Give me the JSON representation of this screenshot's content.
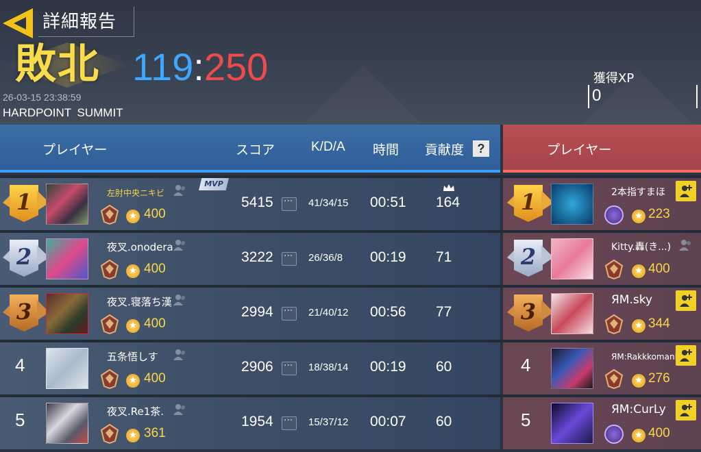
{
  "header": {
    "title": "詳細報告",
    "result": "敗北",
    "score_team": "119",
    "score_sep": ":",
    "score_enemy": "250",
    "datetime": "26-03-15 23:38:59",
    "mode": "HARDPOINT SUMMIT",
    "xp_label": "獲得XP",
    "xp_value": "0"
  },
  "columns": {
    "player": "プレイヤー",
    "score": "スコア",
    "kda": "K/D/A",
    "time": "時間",
    "contribution": "貢献度",
    "help": "?",
    "enemy_player": "プレイヤー"
  },
  "badges": {
    "mvp": "MVP"
  },
  "colors": {
    "team": "#3ea8ff",
    "enemy": "#ef4b4b",
    "result": "#f8dc4e"
  },
  "team": [
    {
      "rank": "1",
      "name": "左肘中央ニキビ",
      "coins": "400",
      "score": "5415",
      "kda": "41/34/15",
      "time": "00:51",
      "contribution": "164"
    },
    {
      "rank": "2",
      "name": "夜叉.onodera",
      "coins": "400",
      "score": "3222",
      "kda": "26/36/8",
      "time": "00:19",
      "contribution": "71"
    },
    {
      "rank": "3",
      "name": "夜叉.寝落ち漢",
      "coins": "400",
      "score": "2994",
      "kda": "21/40/12",
      "time": "00:56",
      "contribution": "77"
    },
    {
      "rank": "4",
      "name": "五条悟しす",
      "coins": "400",
      "score": "2906",
      "kda": "18/38/14",
      "time": "00:19",
      "contribution": "60"
    },
    {
      "rank": "5",
      "name": "夜叉.Re1茶.",
      "coins": "361",
      "score": "1954",
      "kda": "15/37/12",
      "time": "00:07",
      "contribution": "60"
    }
  ],
  "enemy": [
    {
      "rank": "1",
      "name": "2本指すまほ",
      "coins": "223"
    },
    {
      "rank": "2",
      "name": "Kitty.轟(き...)",
      "coins": "400"
    },
    {
      "rank": "3",
      "name": "ЯM.sky",
      "coins": "344"
    },
    {
      "rank": "4",
      "name": "ЯM:RakkkomanN",
      "coins": "276"
    },
    {
      "rank": "5",
      "name": "ЯM:CurLy",
      "coins": "400"
    }
  ]
}
